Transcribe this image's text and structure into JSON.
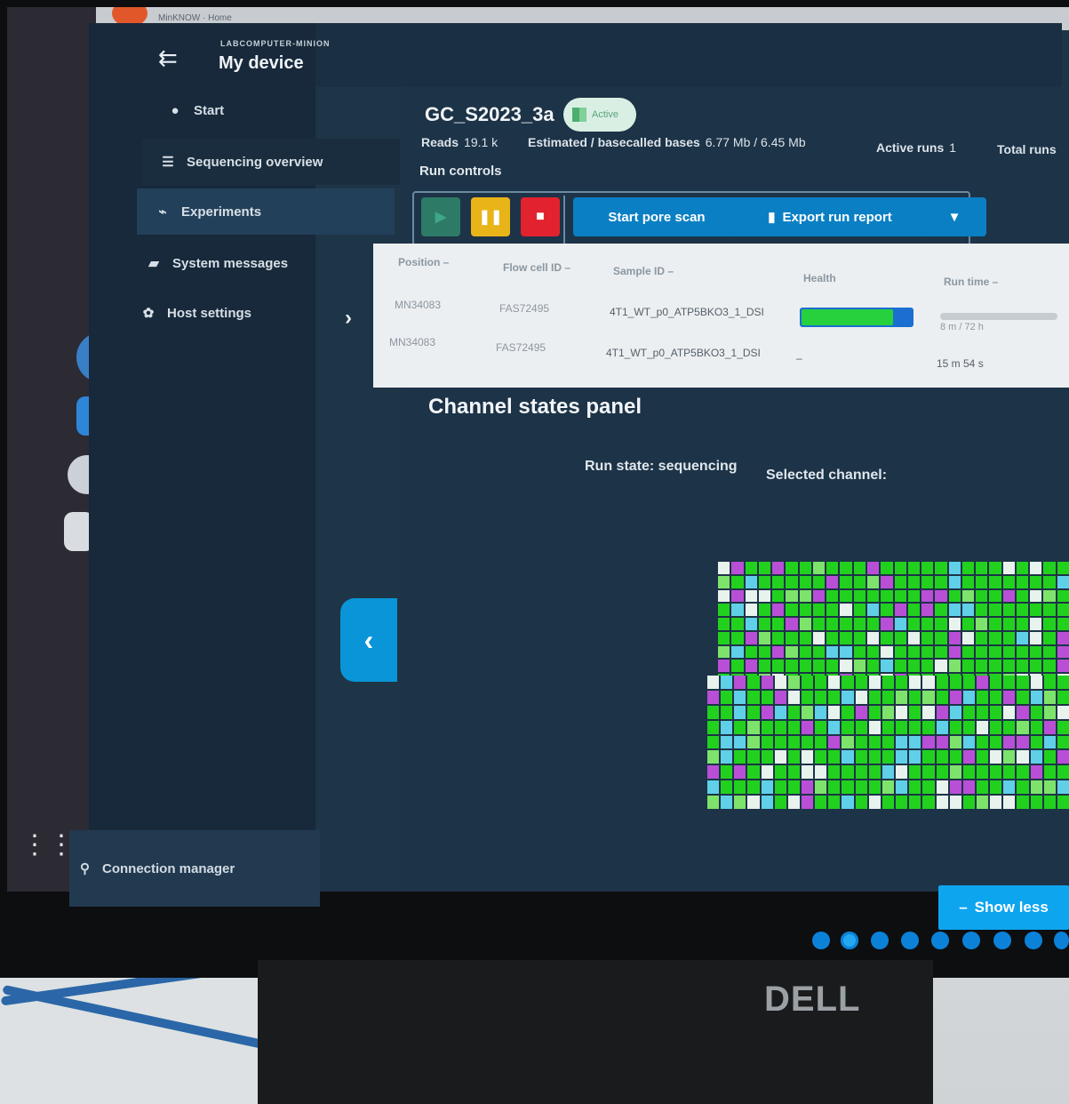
{
  "titlebar": {
    "text": "MinKNOW  ·  Home"
  },
  "header": {
    "menu_icon": "menu-collapse-icon",
    "subtitle": "LABCOMPUTER-MINION",
    "title": "My device"
  },
  "nav": {
    "items": [
      {
        "label": "Start",
        "icon": "start-icon"
      },
      {
        "label": "Sequencing overview",
        "icon": "list-icon"
      },
      {
        "label": "Experiments",
        "icon": "chart-line-icon"
      },
      {
        "label": "System messages",
        "icon": "message-icon"
      },
      {
        "label": "Host settings",
        "icon": "gear-icon"
      }
    ],
    "connection_manager": "Connection manager"
  },
  "run": {
    "name": "GC_S2023_3a",
    "status": "Active",
    "reads_label": "Reads",
    "reads_value": "19.1 k",
    "bases_label": "Estimated / basecalled bases",
    "bases_value": "6.77 Mb / 6.45 Mb",
    "active_runs_label": "Active runs",
    "active_runs_value": "1",
    "total_runs_label": "Total runs"
  },
  "controls": {
    "label": "Run controls",
    "start_pore_scan": "Start pore scan",
    "export_run_report": "Export run report"
  },
  "table": {
    "headers": [
      "Position",
      "Flow cell ID",
      "Sample ID",
      "Health",
      "Run time"
    ],
    "rows": [
      {
        "position": "MN34083",
        "flow_cell": "FAS72495",
        "sample": "4T1_WT_p0_ATP5BKO3_1_DSI",
        "health": 0.83,
        "run_time": "8 m / 72 h"
      },
      {
        "position": "MN34083",
        "flow_cell": "FAS72495",
        "sample": "4T1_WT_p0_ATP5BKO3_1_DSI",
        "health_text": "–",
        "run_time": "15 m 54 s"
      }
    ]
  },
  "channel_panel": {
    "title": "Channel states panel",
    "run_state": "Run state: sequencing",
    "selected_channel": "Selected channel:",
    "show_less": "Show less"
  },
  "brand": {
    "monitor": "DELL"
  },
  "colors": {
    "pore_green": "#22d11e",
    "pore_light_green": "#7ee36b",
    "pore_cyan": "#5fd0e8",
    "pore_white": "#e8f3ee",
    "pore_purple": "#b84fd6",
    "accent_blue": "#0a7fc4"
  }
}
